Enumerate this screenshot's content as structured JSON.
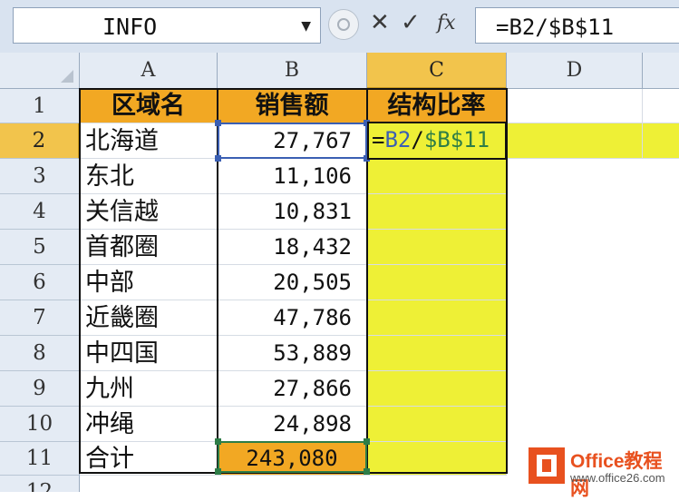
{
  "formula_bar": {
    "name_box": "INFO",
    "cancel_glyph": "✕",
    "enter_glyph": "✓",
    "fx_label": "fx",
    "formula": "=B2/$B$11"
  },
  "columns": [
    "A",
    "B",
    "C",
    "D"
  ],
  "rows": [
    "1",
    "2",
    "3",
    "4",
    "5",
    "6",
    "7",
    "8",
    "9",
    "10",
    "11",
    "12"
  ],
  "table": {
    "headers": [
      "区域名",
      "销售额",
      "结构比率"
    ],
    "data": [
      {
        "region": "北海道",
        "sales": "27,767"
      },
      {
        "region": "东北",
        "sales": "11,106"
      },
      {
        "region": "关信越",
        "sales": "10,831"
      },
      {
        "region": "首都圈",
        "sales": "18,432"
      },
      {
        "region": "中部",
        "sales": "20,505"
      },
      {
        "region": "近畿圈",
        "sales": "47,786"
      },
      {
        "region": "中四国",
        "sales": "53,889"
      },
      {
        "region": "九州",
        "sales": "27,866"
      },
      {
        "region": "冲绳",
        "sales": "24,898"
      }
    ],
    "total_label": "合计",
    "total_value": "243,080"
  },
  "edit_cell": {
    "parts": [
      "=",
      "B2",
      "/",
      "$B$11"
    ]
  },
  "watermark": {
    "brand": "Office教程网",
    "url": "www.office26.com"
  },
  "colors": {
    "header_fill": "#f2a823",
    "highlight_fill": "#eef036",
    "ref_blue": "#3b5fb3",
    "ref_green": "#2e7d47",
    "selected_header": "#f2c44c"
  }
}
